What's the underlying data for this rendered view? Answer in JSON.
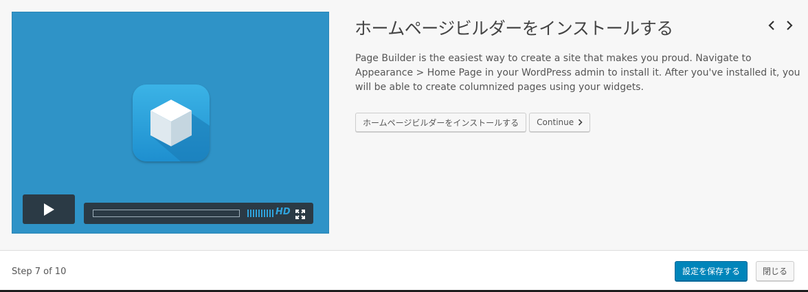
{
  "tour": {
    "title": "ホームページビルダーをインストールする",
    "description": "Page Builder is the easiest way to create a site that makes you proud. Navigate to Appearance > Home Page in your WordPress admin to install it. After you've installed it, you will be able to create columnized pages using your widgets.",
    "install_button_label": "ホームページビルダーをインストールする",
    "continue_button_label": "Continue",
    "nav": {
      "prev_icon": "chevron-left-icon",
      "next_icon": "chevron-right-icon"
    }
  },
  "video": {
    "hd_label": "HD",
    "progress": 0,
    "volume_bars": 10,
    "colors": {
      "background": "#2f93c7",
      "controls": "#2b3a45",
      "accent": "#2fa3dd"
    }
  },
  "footer": {
    "step_text": "Step 7 of 10",
    "save_button_label": "設定を保存する",
    "close_button_label": "閉じる",
    "colors": {
      "primary": "#0085ba"
    }
  }
}
